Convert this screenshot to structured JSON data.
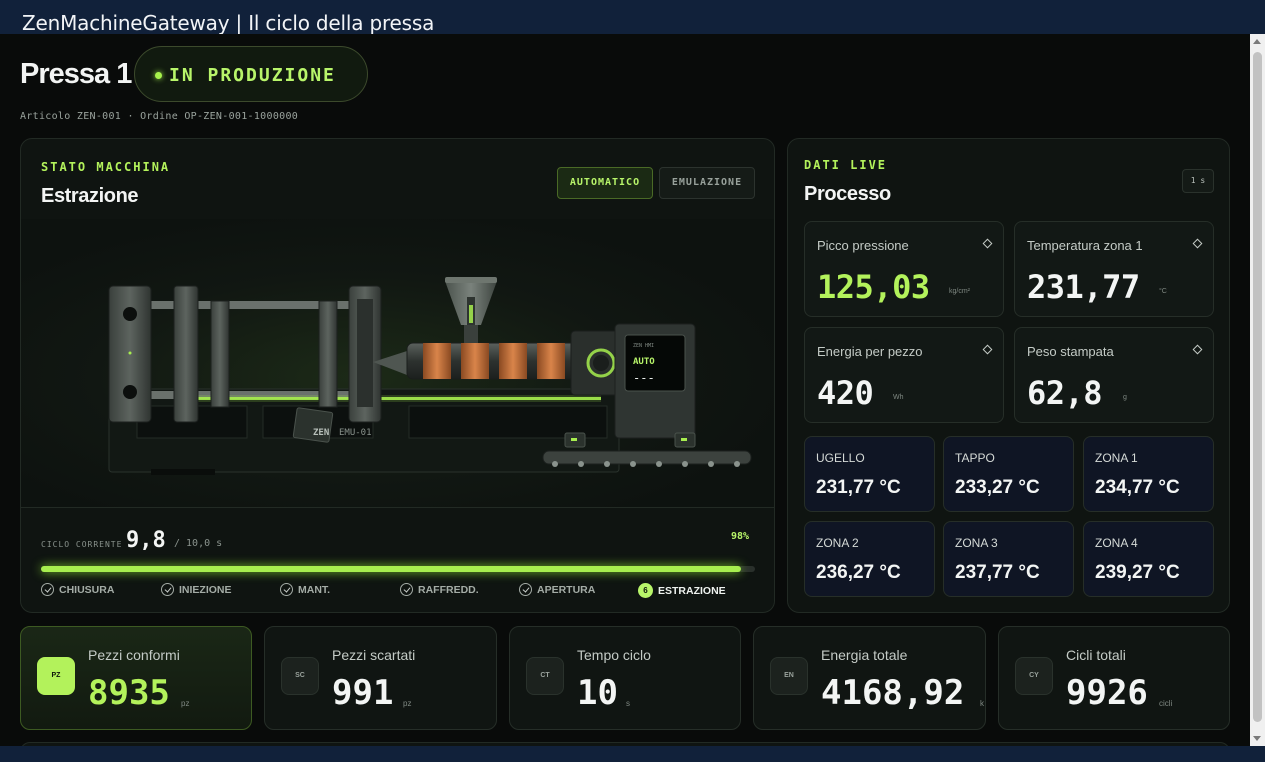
{
  "window": {
    "title": "ZenMachineGateway | Il ciclo della pressa"
  },
  "header": {
    "title": "Pressa 1",
    "status": "IN PRODUZIONE",
    "subline": "Articolo ZEN-001 · Ordine OP-ZEN-001-1000000"
  },
  "machine_state": {
    "kicker": "STATO MACCHINA",
    "title": "Estrazione",
    "modes": {
      "auto": "AUTOMATICO",
      "emu": "EMULAZIONE"
    },
    "screen_small": "ZEN HMI",
    "screen_mode": "AUTO",
    "screen_value": "---",
    "plate_label": "ZEN",
    "plate_code": "EMU-01",
    "cycle": {
      "label": "CICLO CORRENTE",
      "value": "9,8",
      "total": "/ 10,0 s",
      "percent": "98%",
      "progress": 0.98
    },
    "phases": [
      {
        "label": "CHIUSURA"
      },
      {
        "label": "INIEZIONE"
      },
      {
        "label": "MANT."
      },
      {
        "label": "RAFFREDD."
      },
      {
        "label": "APERTURA"
      },
      {
        "label": "ESTRAZIONE",
        "number": "6"
      }
    ]
  },
  "live": {
    "kicker": "DATI LIVE",
    "title": "Processo",
    "rate": "1 s",
    "cards": [
      {
        "label": "Picco pressione",
        "value": "125,03",
        "unit": "kg/cm²"
      },
      {
        "label": "Temperatura zona 1",
        "value": "231,77",
        "unit": "°C"
      },
      {
        "label": "Energia per pezzo",
        "value": "420",
        "unit": "Wh"
      },
      {
        "label": "Peso stampata",
        "value": "62,8",
        "unit": "g"
      }
    ],
    "zones": [
      {
        "label": "UGELLO",
        "value": "231,77 °C"
      },
      {
        "label": "TAPPO",
        "value": "233,27 °C"
      },
      {
        "label": "ZONA 1",
        "value": "234,77 °C"
      },
      {
        "label": "ZONA 2",
        "value": "236,27 °C"
      },
      {
        "label": "ZONA 3",
        "value": "237,77 °C"
      },
      {
        "label": "ZONA 4",
        "value": "239,27 °C"
      }
    ]
  },
  "kpis": [
    {
      "badge": "PZ",
      "label": "Pezzi conformi",
      "value": "8935",
      "unit": "pz"
    },
    {
      "badge": "SC",
      "label": "Pezzi scartati",
      "value": "991",
      "unit": "pz"
    },
    {
      "badge": "CT",
      "label": "Tempo ciclo",
      "value": "10",
      "unit": "s"
    },
    {
      "badge": "EN",
      "label": "Energia totale",
      "value": "4168,92",
      "unit": "k"
    },
    {
      "badge": "CY",
      "label": "Cicli totali",
      "value": "9926",
      "unit": "cicli"
    }
  ],
  "colors": {
    "accent": "#b3f25b",
    "copper": "#c9743c",
    "panel": "#0f1411"
  }
}
